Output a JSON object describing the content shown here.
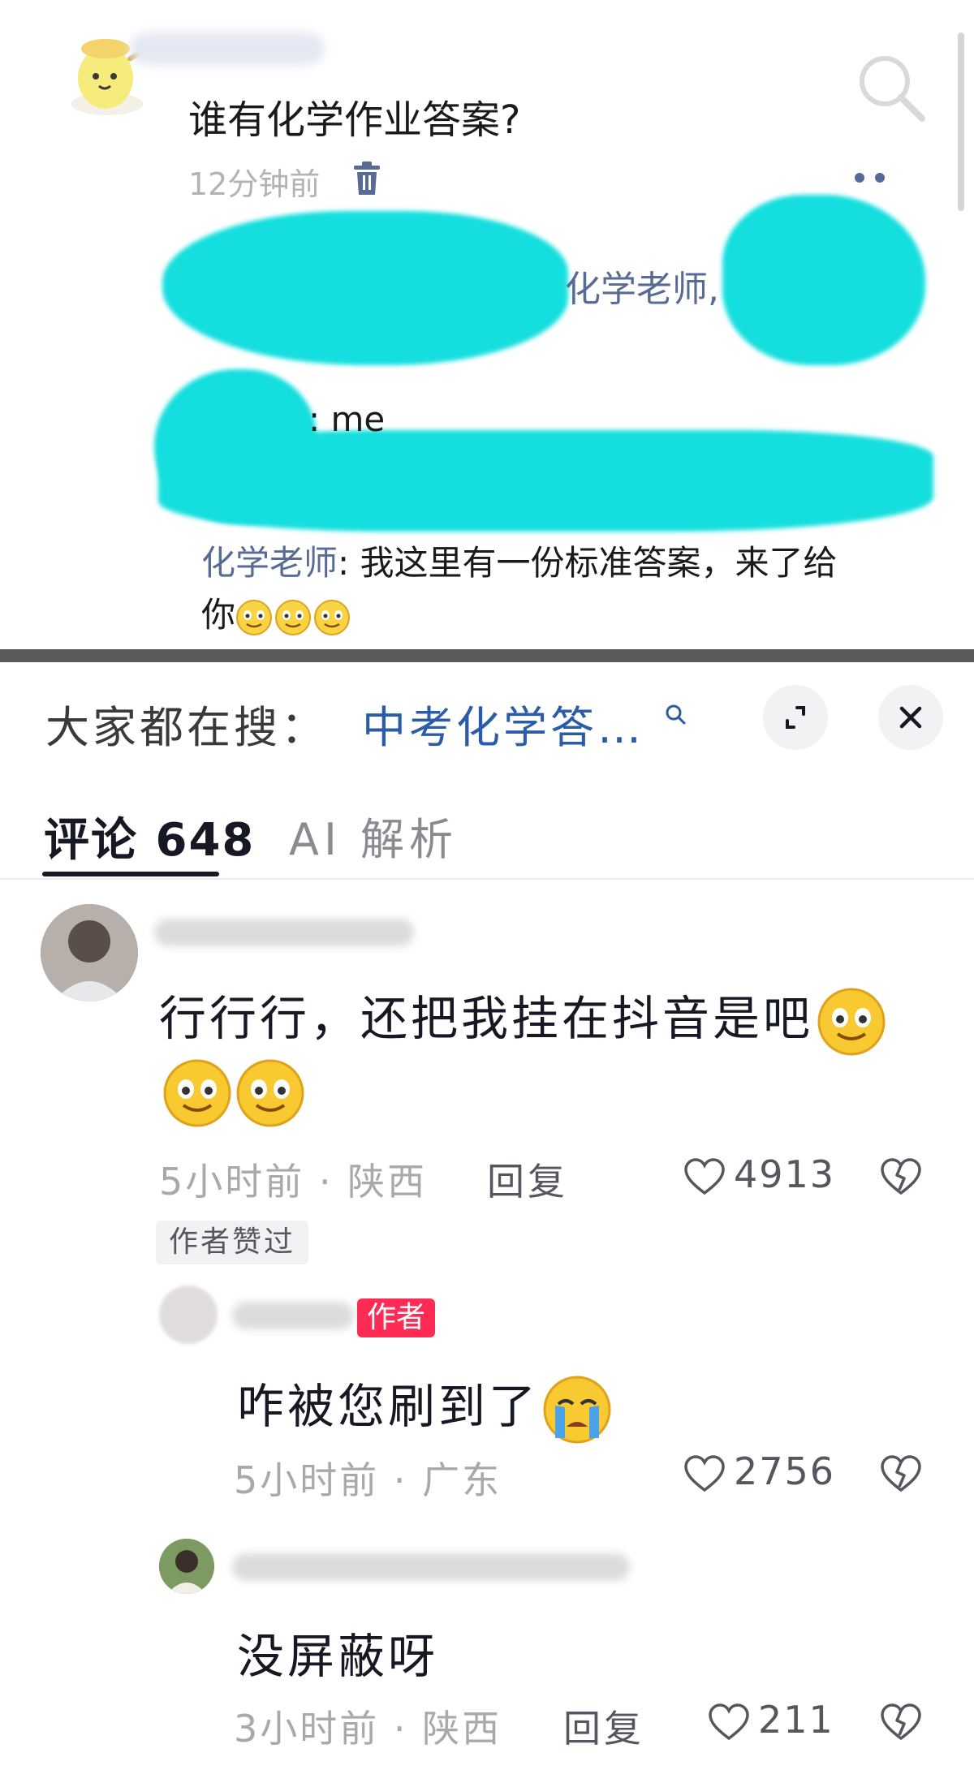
{
  "post": {
    "question": "谁有化学作业答案?",
    "time": "12分钟前",
    "mention_name": "化学老师",
    "mention_suffix": ",",
    "me_text": ": me",
    "reply_name": "化学老师",
    "reply_text_1": ": 我这里有一份标准答案，来了给",
    "reply_text_2": "你",
    "icons": [
      "trash-icon",
      "search-icon",
      "more-dots-icon",
      "smile-emoji"
    ]
  },
  "panel": {
    "search_label": "大家都在搜：",
    "search_query": "中考化学答…",
    "tabs": [
      {
        "label": "评论 648",
        "active": true
      },
      {
        "label": "AI 解析",
        "active": false
      }
    ],
    "icons": [
      "expand-icon",
      "close-icon",
      "heart-icon",
      "broken-heart-icon"
    ],
    "accent_color": "#fe2c55",
    "link_color": "#2a5ca8"
  },
  "comments": [
    {
      "text_1": "行行行，还把我挂在抖音是吧",
      "text_2": "",
      "meta": "5小时前 · 陕西",
      "reply": "回复",
      "likes": "4913",
      "badge": "作者赞过"
    },
    {
      "author_tag": "作者",
      "text": "咋被您刷到了",
      "meta": "5小时前 · 广东",
      "likes": "2756"
    },
    {
      "text": "没屏蔽呀",
      "meta": "3小时前 · 陕西",
      "reply": "回复",
      "likes": "211"
    }
  ]
}
